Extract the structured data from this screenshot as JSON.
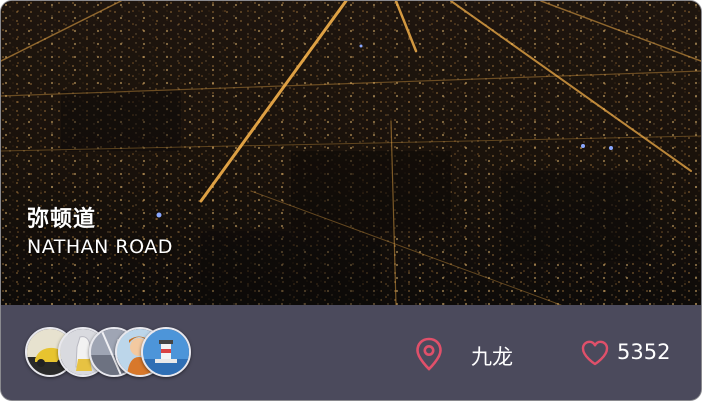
{
  "place": {
    "name_zh": "弥顿道",
    "name_en": "NATHAN ROAD"
  },
  "footer": {
    "avatars": [
      {
        "icon": "car-avatar-icon"
      },
      {
        "icon": "figure-avatar-icon"
      },
      {
        "icon": "street-avatar-icon"
      },
      {
        "icon": "cartoon-avatar-icon"
      },
      {
        "icon": "lighthouse-avatar-icon"
      }
    ],
    "location_icon": "location-pin-icon",
    "location": "九龙",
    "heart_icon": "heart-icon",
    "likes": "5352"
  },
  "colors": {
    "accent": "#e0506a",
    "footer_bg": "#4b4a5c",
    "text": "#ffffff"
  }
}
